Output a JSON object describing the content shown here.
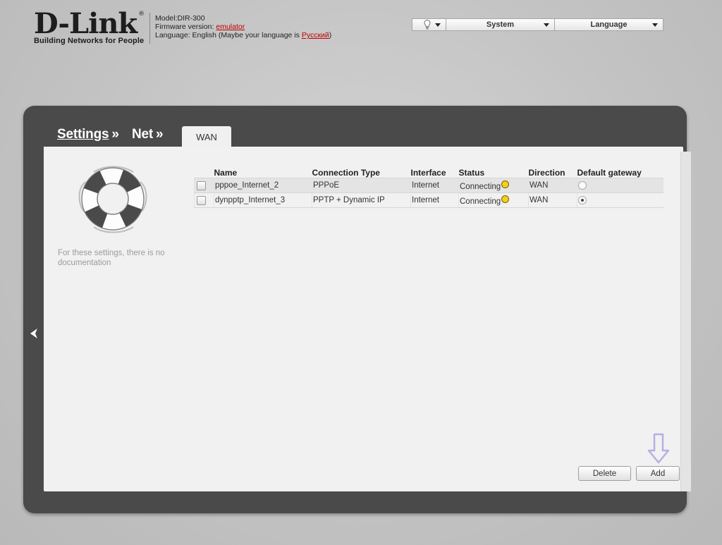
{
  "header": {
    "logo_text": "D-Link",
    "logo_reg": "®",
    "logo_tagline": "Building Networks for People",
    "model_label": "Model:",
    "model_value": "DIR-300",
    "firmware_label": "Firmware version: ",
    "firmware_value": "emulator",
    "language_label": "Language: English (Maybe your language is ",
    "language_alt": "Русский",
    "language_tail": ")"
  },
  "toolbar": {
    "hint_icon": "lightbulb-icon",
    "system_label": "System",
    "language_label": "Language"
  },
  "breadcrumb": [
    {
      "label": "Settings",
      "sep": "»"
    },
    {
      "label": "Net",
      "sep": "»"
    }
  ],
  "active_tab": "WAN",
  "help": {
    "icon": "lifebuoy-icon",
    "text": "For these settings, there is no documentation"
  },
  "table": {
    "columns": [
      "Name",
      "Connection Type",
      "Interface",
      "Status",
      "Direction",
      "Default gateway"
    ],
    "rows": [
      {
        "name": "pppoe_Internet_2",
        "type": "PPPoE",
        "interface": "Internet",
        "status": "Connecting",
        "direction": "WAN",
        "default_gateway": false
      },
      {
        "name": "dynpptp_Internet_3",
        "type": "PPTP + Dynamic IP",
        "interface": "Internet",
        "status": "Connecting",
        "direction": "WAN",
        "default_gateway": true
      }
    ]
  },
  "buttons": {
    "delete": "Delete",
    "add": "Add"
  },
  "colors": {
    "frame": "#4a4a4a",
    "panel": "#f1f1f1",
    "status_connecting": "#f3d01e",
    "link_red": "#c00000",
    "hint_arrow": "#b6aee6"
  }
}
